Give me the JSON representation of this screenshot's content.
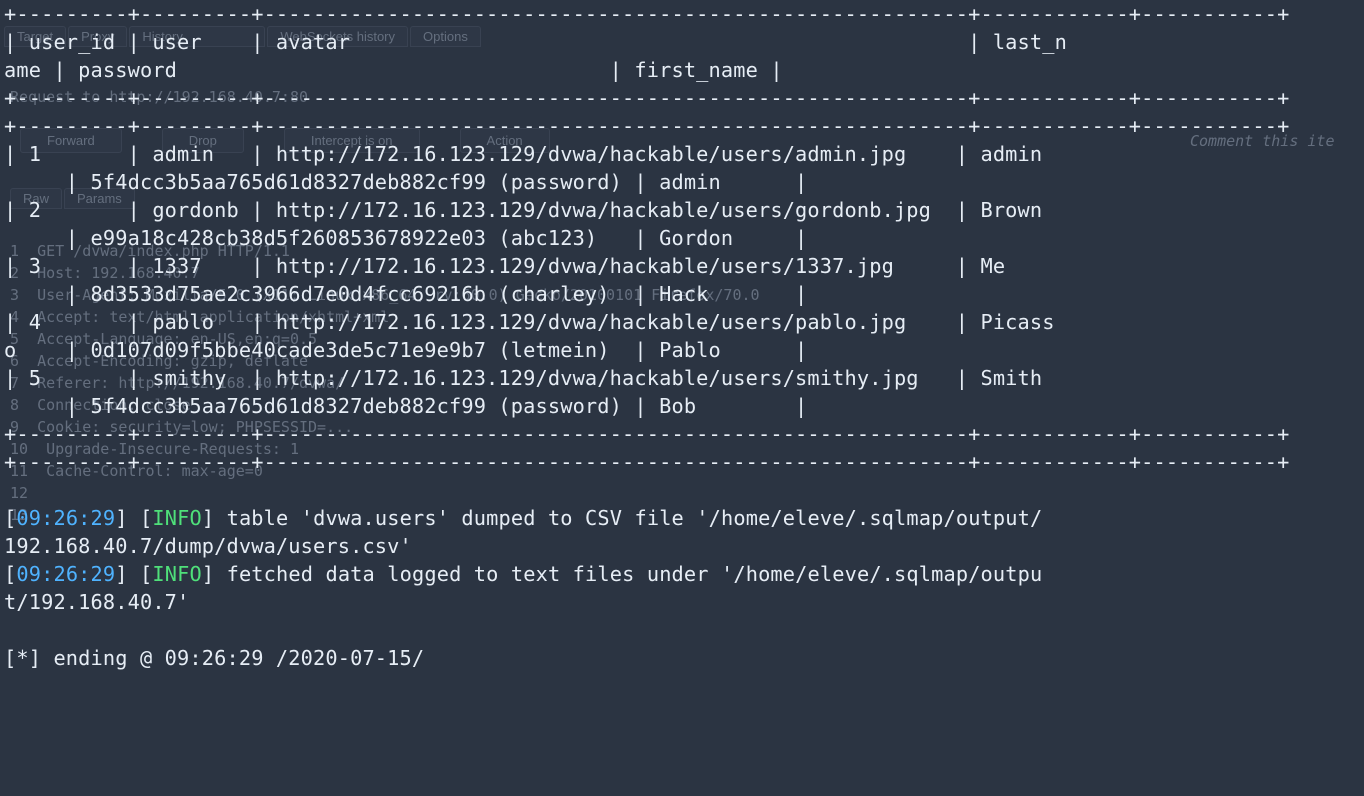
{
  "bg": {
    "tabs": [
      "Target",
      "Proxy",
      "History",
      "WebSockets history",
      "Options"
    ],
    "req_label": "Request to http://192.168.40.7:80",
    "buttons": [
      "Forward",
      "Drop",
      "Intercept is on",
      "Action"
    ],
    "comment": "Comment this ite",
    "subtabs": [
      "Raw",
      "Params"
    ],
    "http": [
      "GET /dvwa/index.php HTTP/1.1",
      "Host: 192.168.40.7",
      "User-Agent: Mozilla/5.0 (X11; Linux x86_64; rv:60.0) Gecko/20100101 Firefox/70.0",
      "Accept: text/html,application/xhtml+xml",
      "Accept-Language: en-US,en;q=0.5",
      "Accept-Encoding: gzip, deflate",
      "Referer: http://192.168.40.7/dvwa/",
      "Connection: close",
      "Cookie: security=low; PHPSESSID=...",
      "Upgrade-Insecure-Requests: 1",
      "Cache-Control: max-age=0",
      "",
      ""
    ]
  },
  "table": {
    "border_top": "+---------+---------+---------------------------------------------------------+------------+-----------+",
    "border_header": "+---------+---------+---------------------------------------------------------+------------+-----------+",
    "border_mid": "+---------+---------+---------------------------------------------------------+------------+-----------+",
    "border_bottom": "+---------+---------+---------------------------------------------------------+------------+-----------+",
    "headers": {
      "line1": "| user_id | user    | avatar                                                  | last_n",
      "line2": "ame | password                                   | first_name |"
    },
    "rows": [
      {
        "l1": "| 1       | admin   | http://172.16.123.129/dvwa/hackable/users/admin.jpg    | admin",
        "l2": "     | 5f4dcc3b5aa765d61d8327deb882cf99 (password) | admin      |"
      },
      {
        "l1": "| 2       | gordonb | http://172.16.123.129/dvwa/hackable/users/gordonb.jpg  | Brown",
        "l2": "     | e99a18c428cb38d5f260853678922e03 (abc123)   | Gordon     |"
      },
      {
        "l1": "| 3       | 1337    | http://172.16.123.129/dvwa/hackable/users/1337.jpg     | Me",
        "l2": "     | 8d3533d75ae2c3966d7e0d4fcc69216b (charley)  | Hack       |"
      },
      {
        "l1": "| 4       | pablo   | http://172.16.123.129/dvwa/hackable/users/pablo.jpg    | Picass",
        "l2": "o    | 0d107d09f5bbe40cade3de5c71e9e9b7 (letmein)  | Pablo      |"
      },
      {
        "l1": "| 5       | smithy  | http://172.16.123.129/dvwa/hackable/users/smithy.jpg   | Smith",
        "l2": "     | 5f4dcc3b5aa765d61d8327deb882cf99 (password) | Bob        |"
      }
    ]
  },
  "log": {
    "ts1": "09:26:29",
    "lvl1": "INFO",
    "msg1a": " table 'dvwa.users' dumped to CSV file '/home/eleve/.sqlmap/output/",
    "msg1b": "192.168.40.7/dump/dvwa/users.csv'",
    "ts2": "09:26:29",
    "lvl2": "INFO",
    "msg2a": " fetched data logged to text files under '/home/eleve/.sqlmap/outpu",
    "msg2b": "t/192.168.40.7'",
    "end_prefix": "[*] ending @ ",
    "end_time": "09:26:29",
    "end_date": " /2020-07-15/"
  }
}
